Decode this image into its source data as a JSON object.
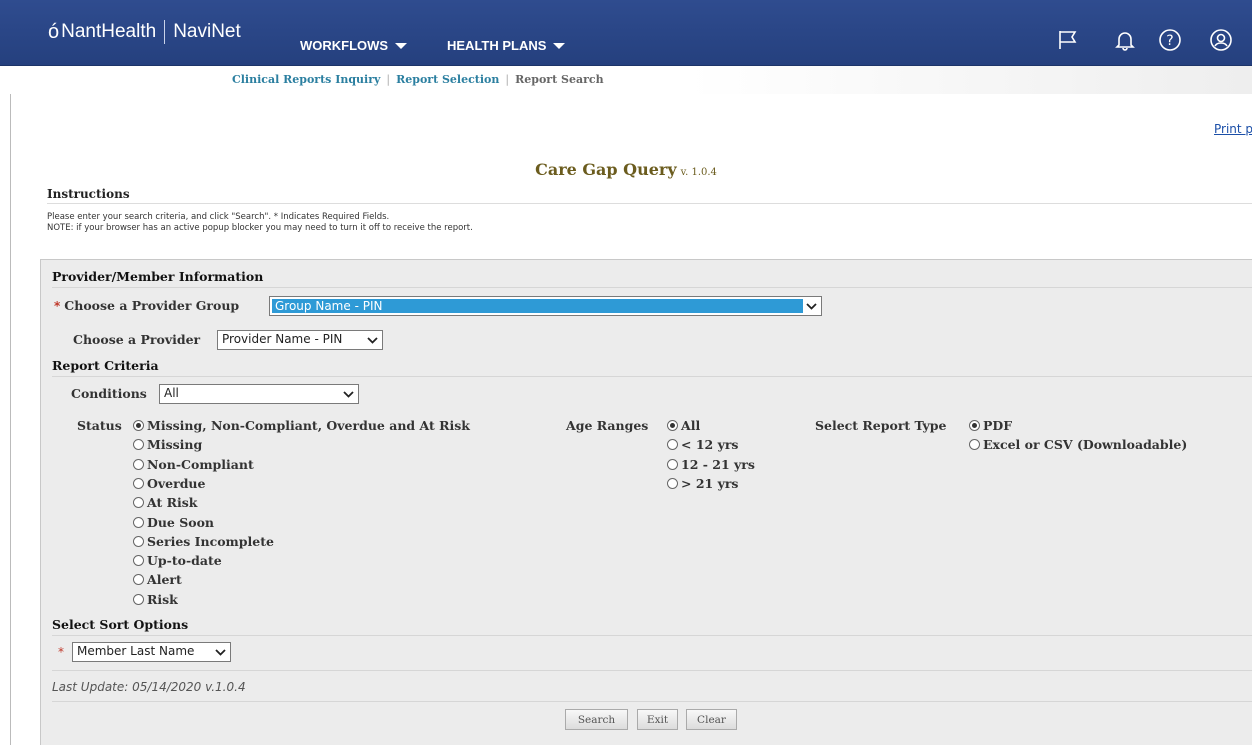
{
  "brand": {
    "company": "NantHealth",
    "product": "NaviNet"
  },
  "nav": {
    "workflows": "WORKFLOWS",
    "health_plans": "HEALTH PLANS"
  },
  "breadcrumb": {
    "item1": "Clinical Reports Inquiry",
    "item2": "Report Selection",
    "current": "Report Search"
  },
  "print_link": "Print page",
  "title": {
    "main": "Care Gap Query",
    "version": "v. 1.0.4"
  },
  "instructions": {
    "heading": "Instructions",
    "line1": "Please enter your search criteria, and click \"Search\".   * Indicates Required Fields.",
    "line2": "NOTE: if your browser has an active popup blocker you may need to turn it off to receive the report."
  },
  "provider_section": {
    "heading": "Provider/Member Information",
    "group_label": "Choose a Provider Group",
    "group_value": "Group Name - PIN",
    "provider_label": "Choose a Provider",
    "provider_value": "Provider Name - PIN"
  },
  "criteria": {
    "heading": "Report Criteria",
    "conditions_label": "Conditions",
    "conditions_value": "All",
    "status_label": "Status",
    "status_options": [
      {
        "label": "Missing, Non-Compliant, Overdue and At Risk",
        "selected": true
      },
      {
        "label": "Missing",
        "selected": false
      },
      {
        "label": "Non-Compliant",
        "selected": false
      },
      {
        "label": "Overdue",
        "selected": false
      },
      {
        "label": "At Risk",
        "selected": false
      },
      {
        "label": "Due Soon",
        "selected": false
      },
      {
        "label": "Series Incomplete",
        "selected": false
      },
      {
        "label": "Up-to-date",
        "selected": false
      },
      {
        "label": "Alert",
        "selected": false
      },
      {
        "label": "Risk",
        "selected": false
      }
    ],
    "age_label": "Age Ranges",
    "age_options": [
      {
        "label": "All",
        "selected": true
      },
      {
        "label": "< 12 yrs",
        "selected": false
      },
      {
        "label": "12 - 21 yrs",
        "selected": false
      },
      {
        "label": "> 21 yrs",
        "selected": false
      }
    ],
    "type_label": "Select Report Type",
    "type_options": [
      {
        "label": "PDF",
        "selected": true
      },
      {
        "label": "Excel or CSV (Downloadable)",
        "selected": false
      }
    ]
  },
  "sort": {
    "heading": "Select Sort Options",
    "value": "Member Last Name"
  },
  "last_update": "Last Update: 05/14/2020 v.1.0.4",
  "buttons": {
    "search": "Search",
    "exit": "Exit",
    "clear": "Clear"
  },
  "required_mark": "*",
  "icons": {
    "flag": "flag-icon",
    "bell": "bell-icon",
    "help": "help-icon",
    "account": "account-icon"
  },
  "colors": {
    "nav_bg": "#2f4c8f",
    "link": "#2b7fa0",
    "title": "#6b5c1e",
    "highlight": "#2e9ad6",
    "required": "#c0392b"
  }
}
